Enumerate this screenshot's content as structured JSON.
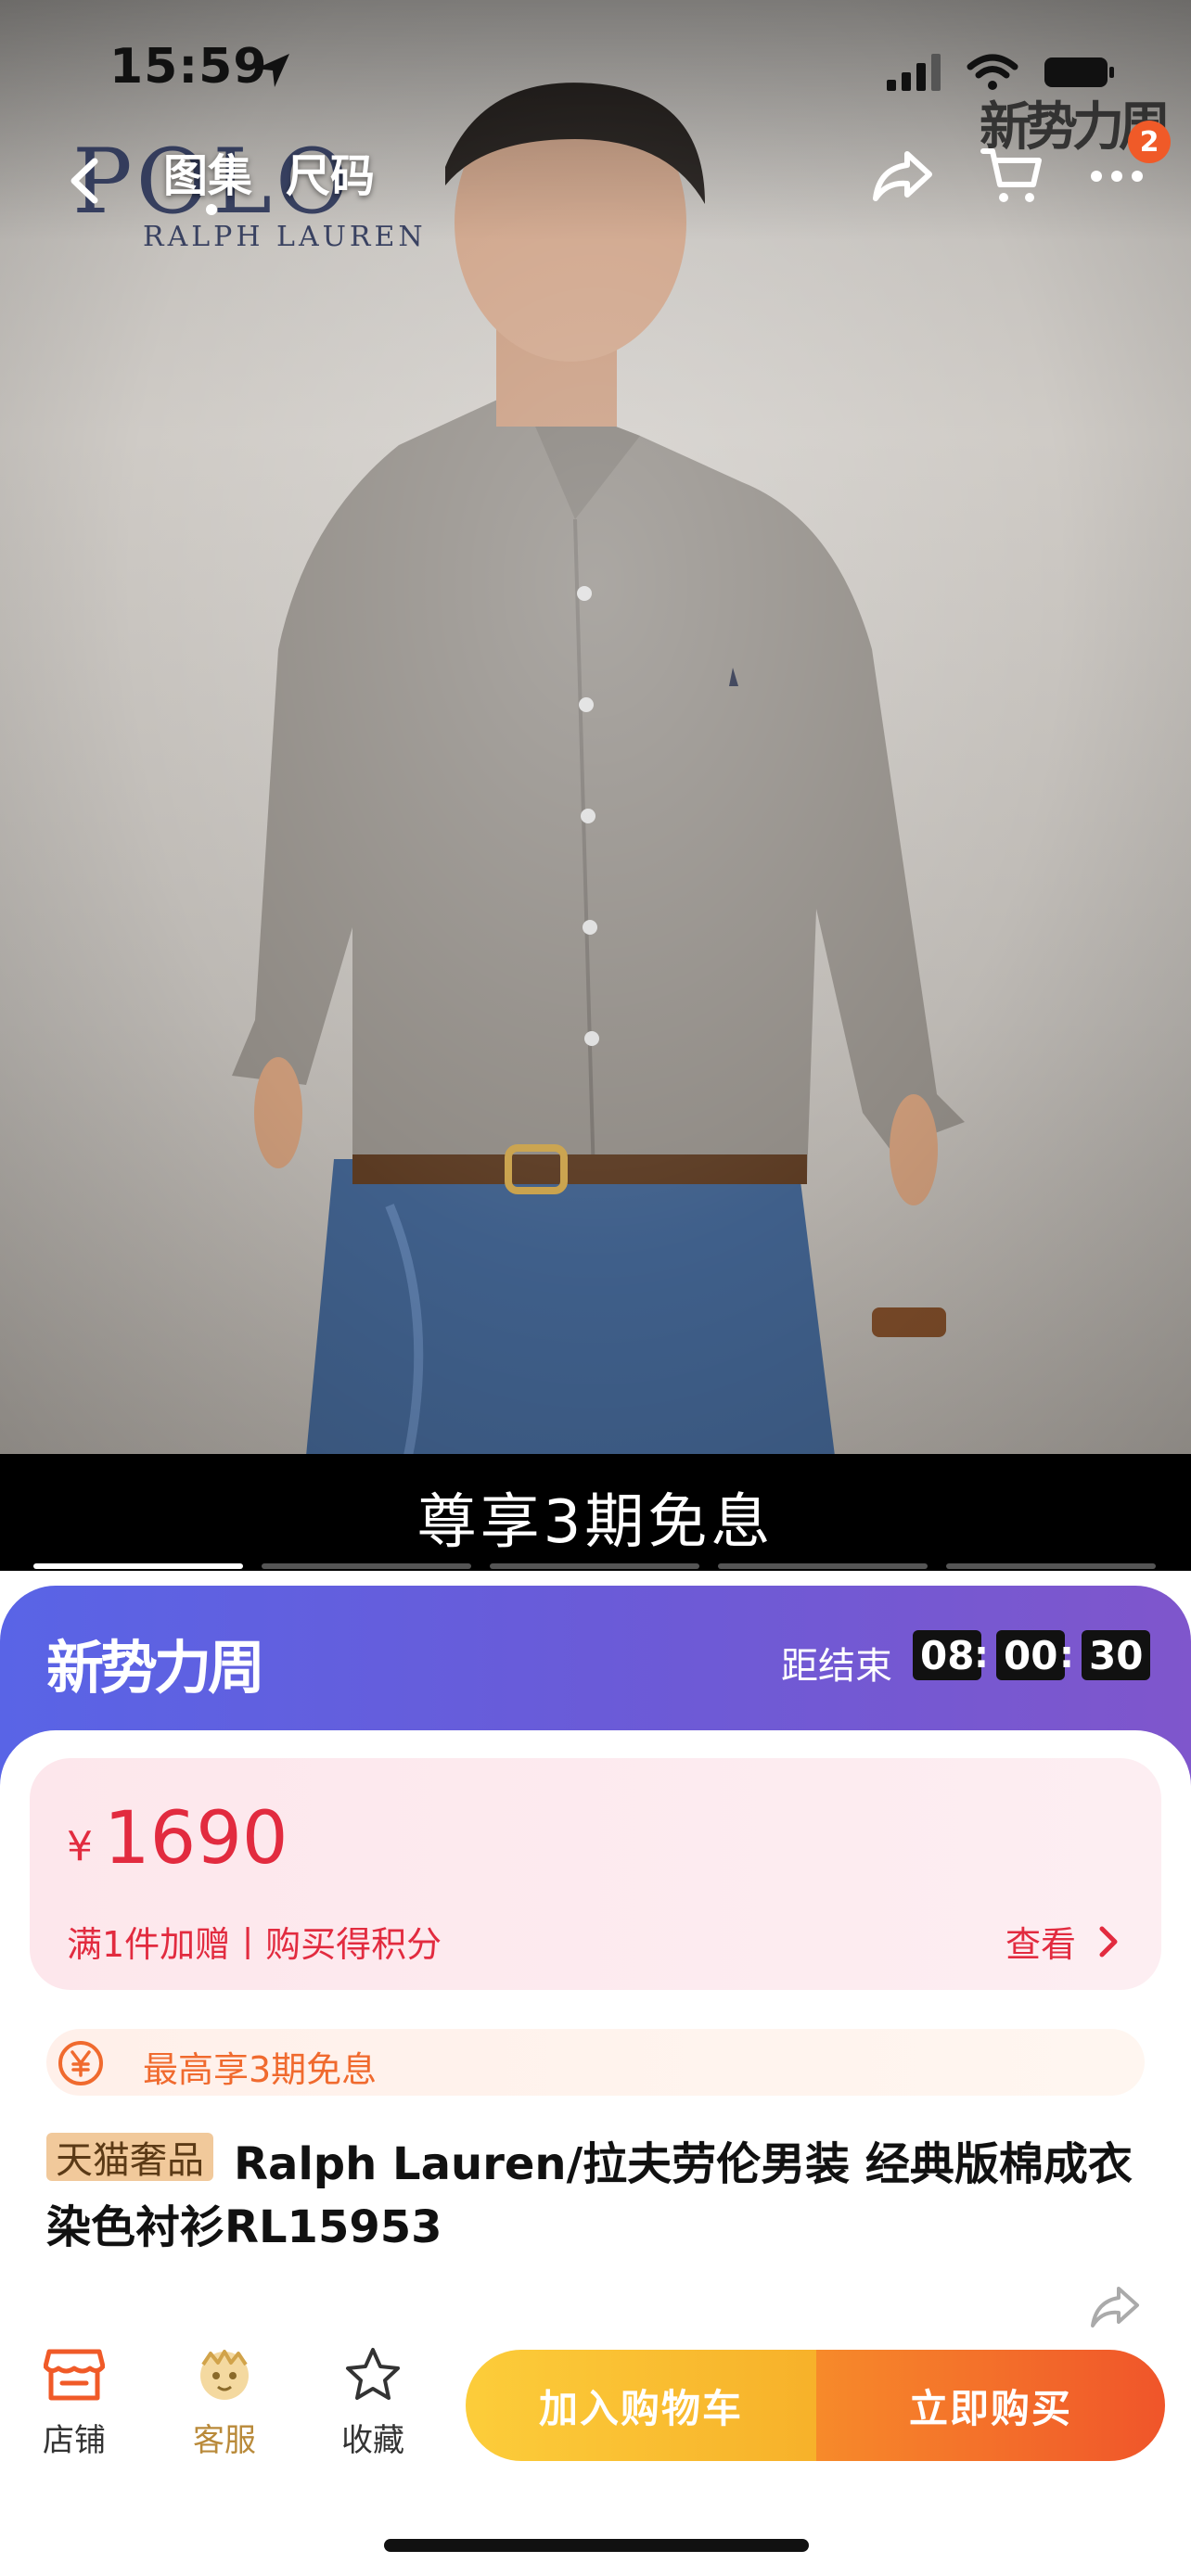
{
  "status_bar": {
    "time": "15:59"
  },
  "nav": {
    "tabs": [
      {
        "label": "图集"
      },
      {
        "label": "尺码"
      }
    ],
    "cart_badge": "2"
  },
  "hero": {
    "brand_text": "POLO",
    "brand_sub": "RALPH LAUREN",
    "watermark": "新势力周"
  },
  "banner": {
    "text": "尊享3期免息",
    "progress_total": 5,
    "progress_active": 1
  },
  "promo": {
    "logo": "新势力周",
    "countdown_label": "距结束",
    "countdown": {
      "hours": "08",
      "minutes": "00",
      "seconds": "30"
    }
  },
  "price": {
    "currency": "¥",
    "value": "1690",
    "subtitle": "满1件加赠丨购买得积分",
    "view_label": "查看"
  },
  "installment": {
    "text": "最高享3期免息"
  },
  "product": {
    "tag": "天猫奢品",
    "title_line1": "Ralph Lauren/拉夫劳伦男装 经典版棉成衣",
    "title_line2": "染色衬衫RL15953"
  },
  "bottom_bar": {
    "shop_label": "店铺",
    "service_label": "客服",
    "favorite_label": "收藏",
    "add_to_cart": "加入购物车",
    "buy_now": "立即购买"
  },
  "colors": {
    "price_red": "#e22b3f",
    "accent_orange": "#f0552a",
    "promo_purple": "#6a5bd8",
    "cart_yellow": "#f7b12a"
  }
}
